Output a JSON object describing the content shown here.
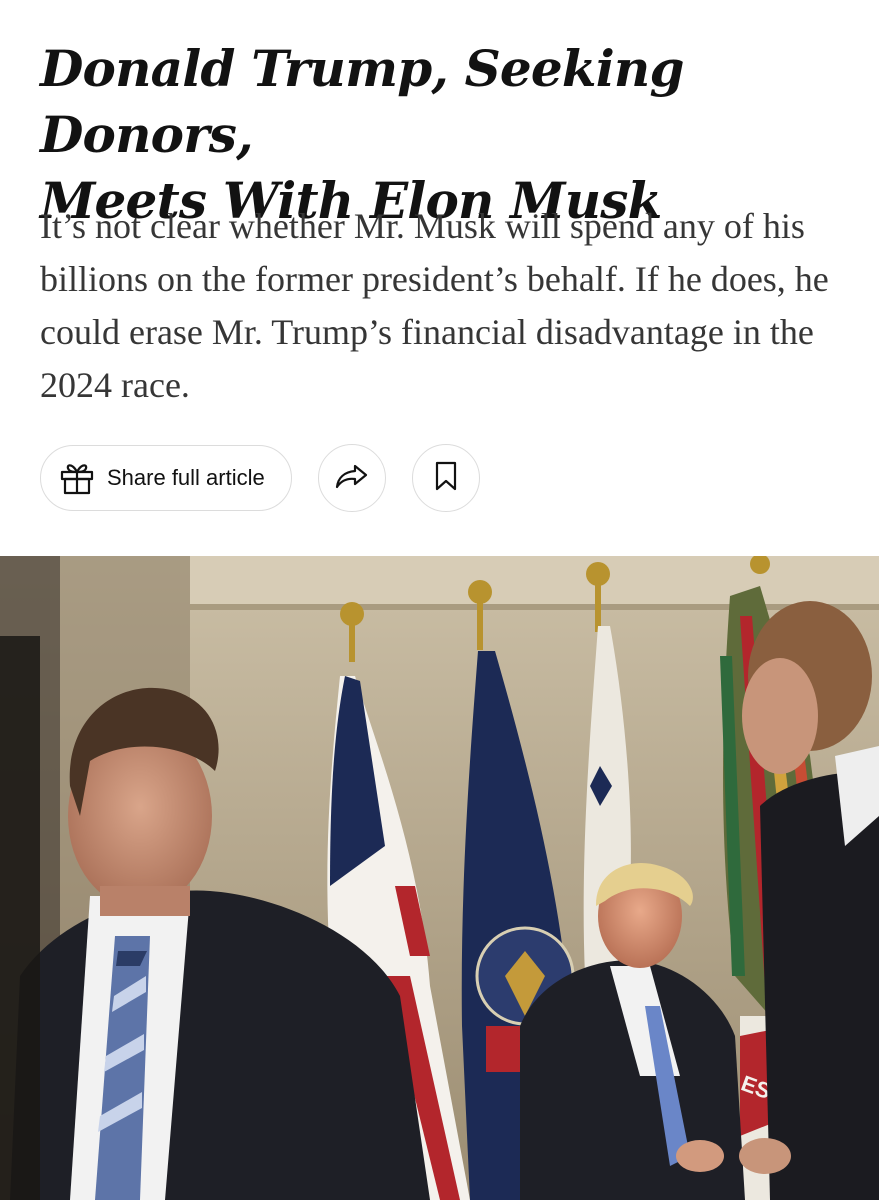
{
  "article": {
    "headline_line1": "Donald Trump, Seeking Donors,",
    "headline_line2": "Meets With Elon Musk",
    "summary": "It’s not clear whether Mr. Musk will spend any of his billions on the former president’s behalf. If he does, he could erase Mr. Trump’s financial disadvantage in the 2024 race."
  },
  "actions": {
    "share_full_label": "Share full article",
    "share_icon": "share-arrow-icon",
    "save_icon": "bookmark-icon",
    "gift_icon": "gift-icon"
  },
  "photo": {
    "flag_text": "ES",
    "colors": {
      "wall": "#b9ab8f",
      "suit": "#1e1f26",
      "flag_red": "#b3262c",
      "flag_blue": "#1c2a55"
    }
  }
}
